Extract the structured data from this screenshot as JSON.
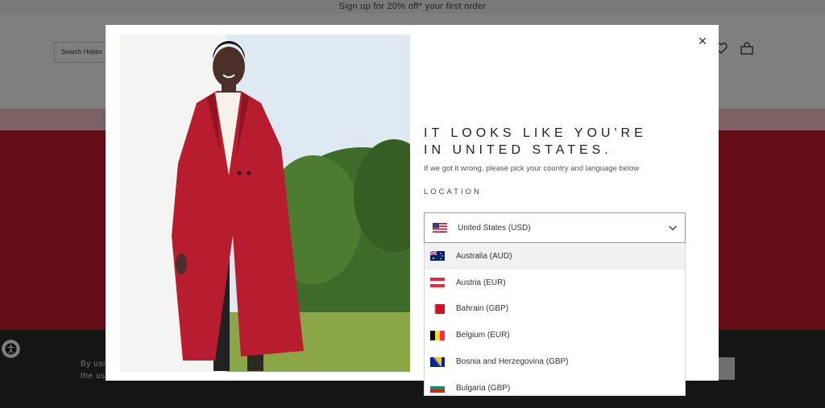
{
  "promo": {
    "text": "Sign up for 20% off* your first order"
  },
  "header": {
    "search_placeholder": "Search Hobbs"
  },
  "footer": {
    "text": "By usi the us"
  },
  "modal": {
    "heading_line1": "IT LOOKS LIKE YOU'RE",
    "heading_line2": "IN UNITED STATES.",
    "subtext": "If we got it wrong, please pick your country and language below",
    "location_label": "LOCATION",
    "selected_country": "United States (USD)",
    "close_icon": "close-icon"
  },
  "dropdown": {
    "options": [
      {
        "label": "Australia (AUD)",
        "flag": "australia"
      },
      {
        "label": "Austria (EUR)",
        "flag": "austria"
      },
      {
        "label": "Bahrain (GBP)",
        "flag": "bahrain"
      },
      {
        "label": "Belgium (EUR)",
        "flag": "belgium"
      },
      {
        "label": "Bosnia and Herzegovina (GBP)",
        "flag": "bosnia"
      },
      {
        "label": "Bulgaria (GBP)",
        "flag": "bulgaria"
      }
    ],
    "highlighted_index": 0
  },
  "colors": {
    "hero_red": "#c81b2c",
    "coat_red": "#b81d2f",
    "footer_dark": "#2b2b2b"
  }
}
